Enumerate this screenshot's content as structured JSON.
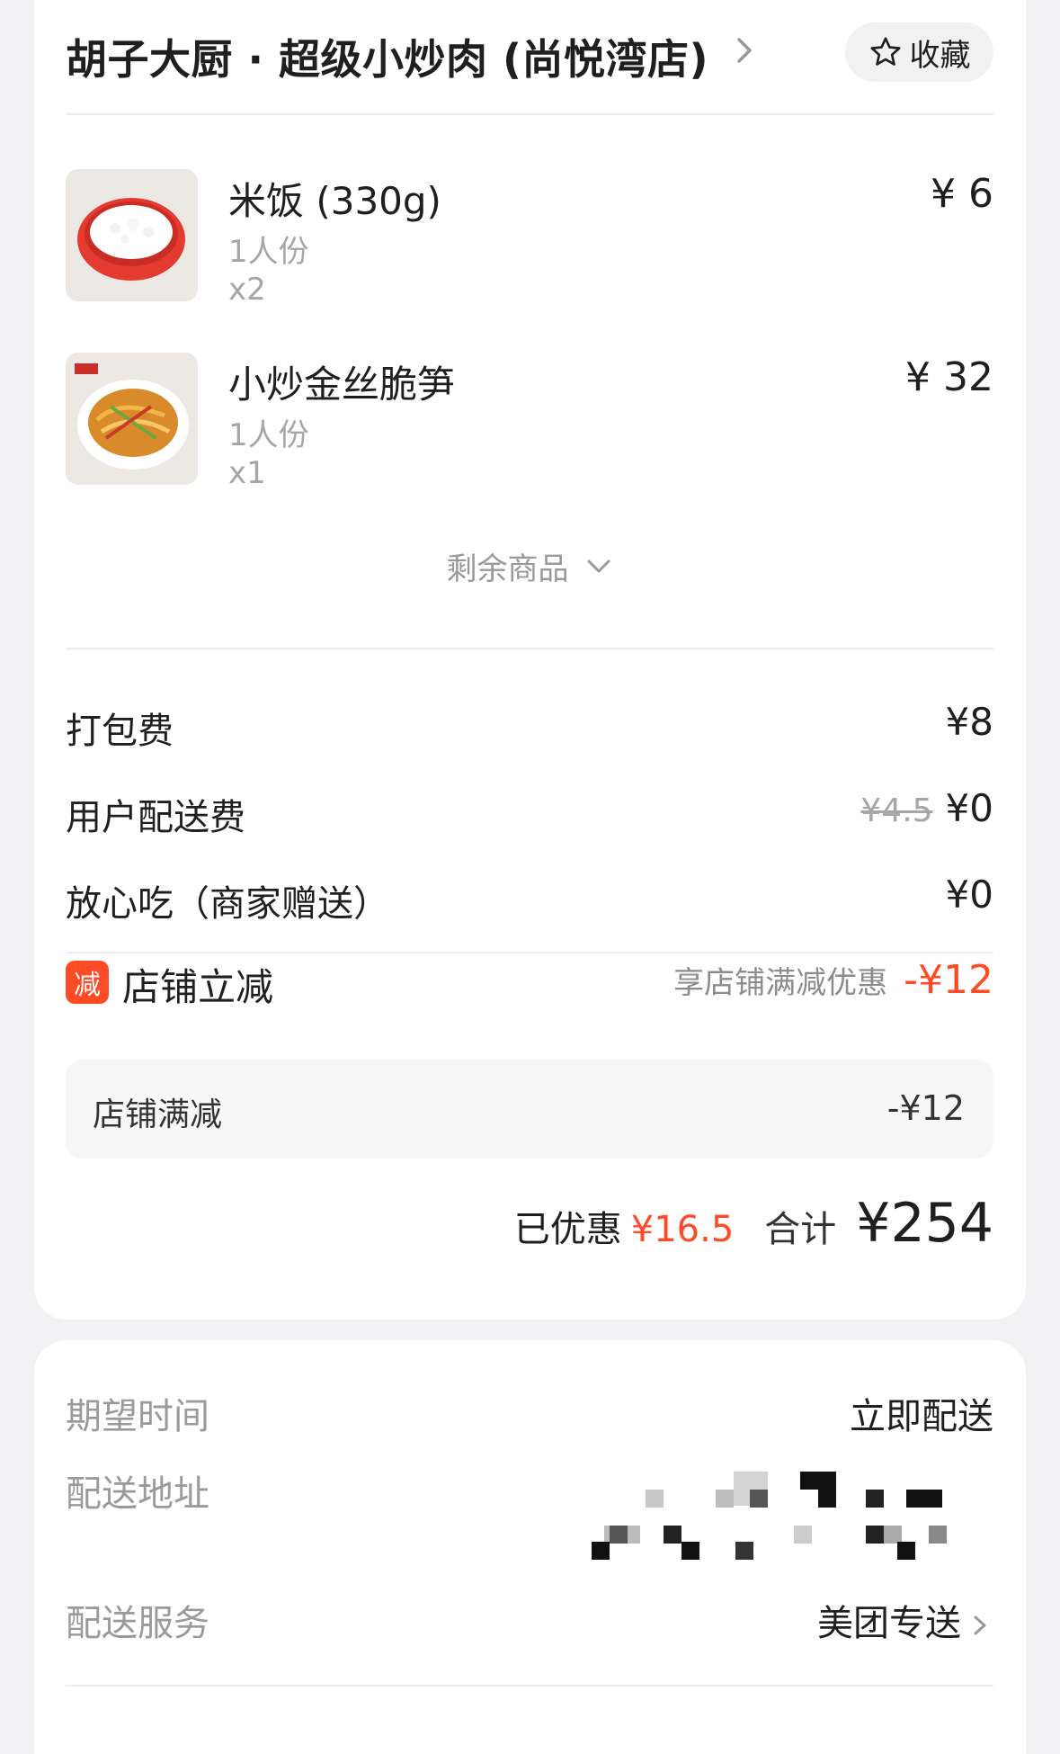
{
  "store": {
    "name": "胡子大厨 · 超级小炒肉 (尚悦湾店)",
    "favorite_label": "收藏"
  },
  "items": [
    {
      "name": "米饭 (330g)",
      "spec": "1人份",
      "qty": "x2",
      "price": "¥ 6",
      "image": "rice-bowl"
    },
    {
      "name": "小炒金丝脆笋",
      "spec": "1人份",
      "qty": "x1",
      "price": "¥ 32",
      "image": "stir-fried-bamboo-shoots"
    }
  ],
  "more_items_label": "剩余商品",
  "fees": {
    "packing": {
      "label": "打包费",
      "value": "¥8"
    },
    "delivery": {
      "label": "用户配送费",
      "original": "¥4.5",
      "value": "¥0"
    },
    "assurance": {
      "label": "放心吃（商家赠送）",
      "value": "¥0"
    }
  },
  "promo": {
    "badge": "减",
    "title": "店铺立减",
    "hint": "享店铺满减优惠",
    "amount": "-¥12",
    "detail_label": "店铺满减",
    "detail_value": "-¥12"
  },
  "totals": {
    "saved_label": "已优惠",
    "saved_amount": "¥16.5",
    "total_label": "合计",
    "total_amount": "¥254"
  },
  "delivery": {
    "time_label": "期望时间",
    "time_value": "立即配送",
    "address_label": "配送地址",
    "service_label": "配送服务",
    "service_value": "美团专送"
  },
  "colors": {
    "accent": "#ff4a26",
    "page_bg": "#f2f2f4",
    "muted": "#a6a6a6"
  }
}
